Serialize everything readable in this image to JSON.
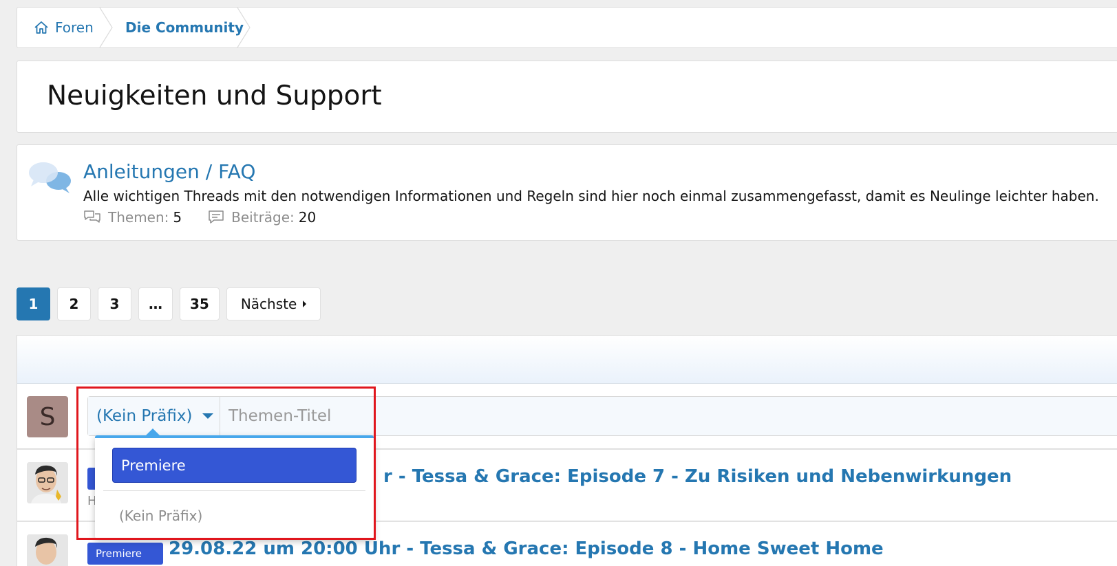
{
  "breadcrumb": {
    "home_label": "Foren",
    "current_label": "Die Community"
  },
  "page": {
    "title": "Neuigkeiten und Support"
  },
  "node": {
    "title": "Anleitungen / FAQ",
    "description": "Alle wichtigen Threads mit den notwendigen Informationen und Regeln sind hier noch einmal zusammengefasst, damit es Neulinge leichter haben.",
    "threads_label": "Themen:",
    "threads_value": "5",
    "posts_label": "Beiträge:",
    "posts_value": "20"
  },
  "pagination": {
    "pages": [
      "1",
      "2",
      "3",
      "…",
      "35"
    ],
    "active": "1",
    "next_label": "Nächste"
  },
  "compose": {
    "avatar_letter": "S",
    "prefix_label": "(Kein Präfix)",
    "title_placeholder": "Themen-Titel"
  },
  "prefix_menu": {
    "options": [
      "Premiere",
      "(Kein Präfix)"
    ],
    "selected": "Premiere"
  },
  "threads": [
    {
      "title_visible": "r - Tessa & Grace: Episode 7 - Zu Risiken und Nebenwirkungen",
      "meta_visible": "H"
    },
    {
      "badge": "Premiere",
      "title_visible": "29.08.22 um 20:00 Uhr - Tessa & Grace: Episode 8 - Home Sweet Home"
    }
  ],
  "colors": {
    "link": "#2577b1",
    "badge": "#3457d5",
    "highlight": "#e0161d",
    "dropdown_accent": "#47a7eb"
  }
}
